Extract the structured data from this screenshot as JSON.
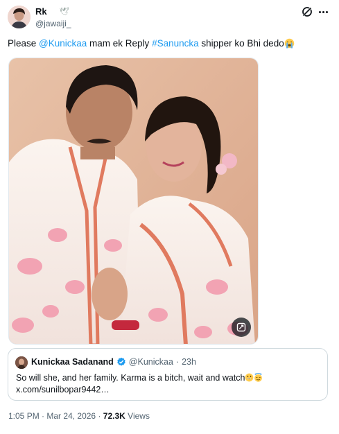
{
  "author": {
    "display_name": "Rk",
    "name_emoji": "🕊",
    "handle": "@jawaiji_"
  },
  "tweet": {
    "text_parts": [
      {
        "kind": "text",
        "value": "Please "
      },
      {
        "kind": "mention",
        "value": "@Kunickaa"
      },
      {
        "kind": "text",
        "value": " mam ek Reply "
      },
      {
        "kind": "hashtag",
        "value": "#Sanunckа"
      },
      {
        "kind": "text",
        "value": " shipper ko Bhi dedo"
      }
    ],
    "emoji": "crying-face"
  },
  "media": {
    "alt": "photo",
    "button_icon": "alt-text-icon"
  },
  "quote": {
    "display_name": "Kunickaa Sadanand",
    "verified": true,
    "handle": "@Kunickaa",
    "separator": "·",
    "time": "23h",
    "line1": "So will she, and her family. Karma is a bitch, wait and watch",
    "line2": "x.com/sunilbopar9442…",
    "emojis": [
      "grinning-face",
      "smiling-face-with-halo"
    ]
  },
  "footer": {
    "time": "1:05 PM",
    "sep": "·",
    "date": "Mar 24, 2026",
    "sep2": "·",
    "views_count": "72.3K",
    "views_label": "Views"
  },
  "colors": {
    "link": "#1d9bf0",
    "secondary": "#536471",
    "verified": "#1d9bf0"
  }
}
